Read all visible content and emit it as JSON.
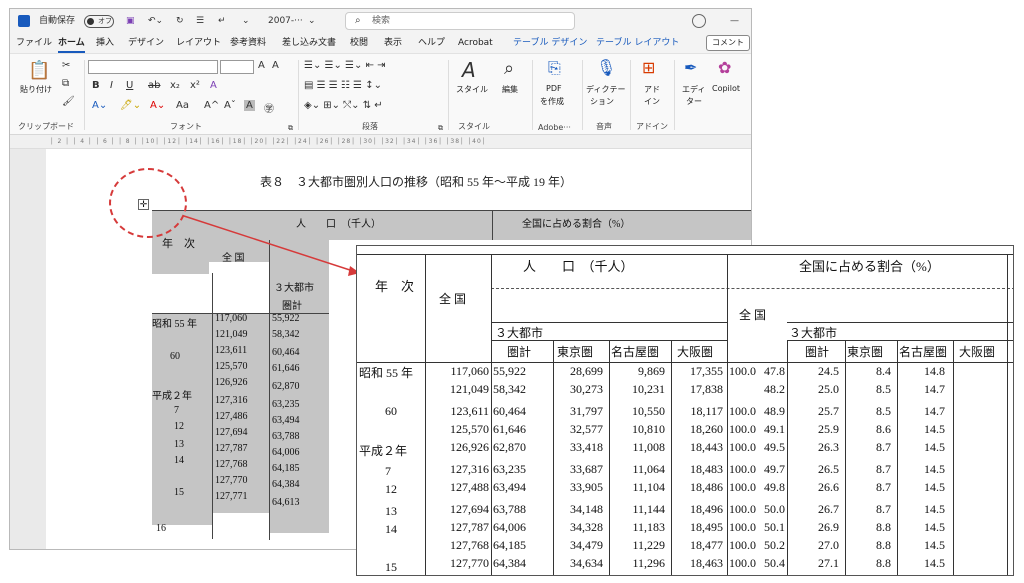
{
  "window": {
    "autosave_label": "自動保存",
    "autosave_state": "オフ",
    "doc_name": "2007-···",
    "search_placeholder": "検索",
    "minimize": "—"
  },
  "tabs": [
    "ファイル",
    "ホーム",
    "挿入",
    "デザイン",
    "レイアウト",
    "参考資料",
    "差し込み文書",
    "校閲",
    "表示",
    "ヘルプ",
    "Acrobat",
    "テーブル デザイン",
    "テーブル レイアウト"
  ],
  "comment_button": "コメント",
  "ribbon": {
    "clipboard": {
      "paste": "貼り付け",
      "group": "クリップボード"
    },
    "font": {
      "group": "フォント",
      "bold": "B",
      "italic": "I",
      "underline": "U",
      "strike": "ab",
      "sub": "x₂",
      "sup": "x²",
      "caseA": "Aa",
      "grow": "A^",
      "shrink": "Aˇ",
      "clear": "A",
      "charbox": "A"
    },
    "paragraph": {
      "group": "段落"
    },
    "styles": {
      "label": "スタイル",
      "group": "スタイル"
    },
    "editing": {
      "label": "編集"
    },
    "pdf": {
      "label1": "PDF",
      "label2": "を作成",
      "group": "Adobe···"
    },
    "dictate": {
      "label1": "ディクテー",
      "label2": "ション",
      "group": "音声"
    },
    "addin": {
      "label1": "アド",
      "label2": "イン",
      "group": "アドイン"
    },
    "editor": {
      "label1": "エディ",
      "label2": "ター"
    },
    "copilot": {
      "label": "Copilot"
    }
  },
  "ruler_text": "│ 2 │ │ 4 │ │ 6 │ │ 8 │ │10│ │12│ │14│ │16│ │18│ │20│ │22│ │24│ │26│ │28│ │30│ │32│ │34│ │36│ │38│ │40│",
  "document": {
    "title": "表８　３大都市圏別人口の推移（昭和 55 年〜平成 19 年）",
    "header": {
      "nenji": "年　次",
      "population": "人　　口　（千人）",
      "share": "全国に占める割合（%）",
      "zenkoku": "全 国",
      "sandai": "３大都市",
      "kenkei": "圏計"
    },
    "years": [
      "昭和 55 年",
      "",
      "60",
      "",
      "平成２年",
      "7",
      "12",
      "13",
      "14",
      "",
      "15",
      "",
      "16"
    ],
    "zenkoku": [
      "117,060",
      "121,049",
      "123,611",
      "125,570",
      "126,926",
      "127,316",
      "127,486",
      "127,694",
      "127,787",
      "127,768",
      "127,770",
      "127,771"
    ],
    "kenkei": [
      "55,922",
      "58,342",
      "60,464",
      "61,646",
      "62,870",
      "63,235",
      "63,494",
      "63,788",
      "64,006",
      "64,185",
      "64,384",
      "64,613"
    ]
  },
  "zoom": {
    "header": {
      "nenji": "年　次",
      "population": "人　　口　（千人）",
      "share": "全国に占める割合（%）",
      "zenkoku": "全 国",
      "zenkoku2": "全 国",
      "sandai": "３大都市",
      "sandai2": "３大都市",
      "cols": [
        "圏計",
        "東京圏",
        "名古屋圏",
        "大阪圏"
      ],
      "cols2": [
        "圏計",
        "東京圏",
        "名古屋圏",
        "大阪圏"
      ]
    },
    "years": [
      "昭和 55 年",
      "",
      "60",
      "",
      "平成２年",
      "7",
      "12",
      "13",
      "14",
      "",
      "",
      "15"
    ],
    "rows": [
      [
        "117,060",
        "55,922",
        "28,699",
        "9,869",
        "17,355",
        "100.0",
        "47.8",
        "24.5",
        "8.4",
        "14.8"
      ],
      [
        "121,049",
        "58,342",
        "30,273",
        "10,231",
        "17,838",
        "",
        "48.2",
        "25.0",
        "8.5",
        "14.7"
      ],
      [
        "123,611",
        "60,464",
        "31,797",
        "10,550",
        "18,117",
        "100.0",
        "48.9",
        "25.7",
        "8.5",
        "14.7"
      ],
      [
        "125,570",
        "61,646",
        "32,577",
        "10,810",
        "18,260",
        "100.0",
        "49.1",
        "25.9",
        "8.6",
        "14.5"
      ],
      [
        "126,926",
        "62,870",
        "33,418",
        "11,008",
        "18,443",
        "100.0",
        "49.5",
        "26.3",
        "8.7",
        "14.5"
      ],
      [
        "127,316",
        "63,235",
        "33,687",
        "11,064",
        "18,483",
        "100.0",
        "49.7",
        "26.5",
        "8.7",
        "14.5"
      ],
      [
        "127,488",
        "63,494",
        "33,905",
        "11,104",
        "18,486",
        "100.0",
        "49.8",
        "26.6",
        "8.7",
        "14.5"
      ],
      [
        "127,694",
        "63,788",
        "34,148",
        "11,144",
        "18,496",
        "100.0",
        "50.0",
        "26.7",
        "8.7",
        "14.5"
      ],
      [
        "127,787",
        "64,006",
        "34,328",
        "11,183",
        "18,495",
        "100.0",
        "50.1",
        "26.9",
        "8.8",
        "14.5"
      ],
      [
        "127,768",
        "64,185",
        "34,479",
        "11,229",
        "18,477",
        "100.0",
        "50.2",
        "27.0",
        "8.8",
        "14.5"
      ],
      [
        "127,770",
        "64,384",
        "34,634",
        "11,296",
        "18,463",
        "100.0",
        "50.4",
        "27.1",
        "8.8",
        "14.5"
      ]
    ]
  },
  "colors": {
    "accent": "#185abd",
    "annotation": "#d63a3a",
    "cell_gray": "#c5c5c5"
  }
}
